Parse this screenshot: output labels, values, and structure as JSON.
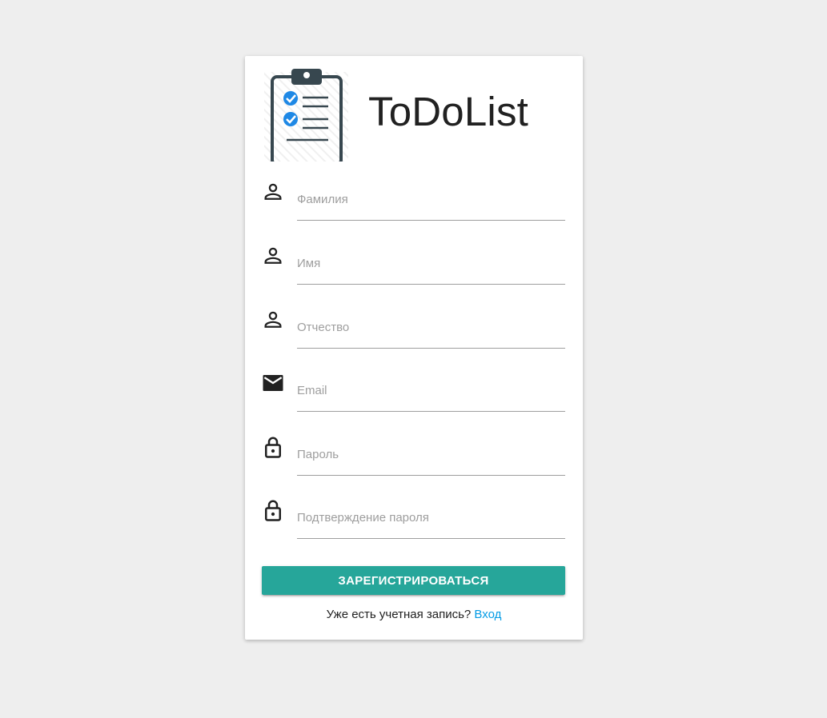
{
  "app": {
    "title": "ToDoList"
  },
  "form": {
    "fields": [
      {
        "placeholder": "Фамилия",
        "value": "",
        "icon": "person-icon"
      },
      {
        "placeholder": "Имя",
        "value": "",
        "icon": "person-icon"
      },
      {
        "placeholder": "Отчество",
        "value": "",
        "icon": "person-icon"
      },
      {
        "placeholder": "Email",
        "value": "",
        "icon": "email-icon"
      },
      {
        "placeholder": "Пароль",
        "value": "",
        "icon": "lock-icon"
      },
      {
        "placeholder": "Подтверждение пароля",
        "value": "",
        "icon": "lock-icon"
      }
    ],
    "submit_label": "ЗАРЕГИСТРИРОВАТЬСЯ",
    "login_prompt": "Уже есть учетная запись?",
    "login_link": "Вход"
  },
  "colors": {
    "accent": "#26a69a",
    "link": "#039be5",
    "background": "#eeeeee",
    "logo_dark": "#37474f",
    "logo_check": "#1e88e5"
  }
}
